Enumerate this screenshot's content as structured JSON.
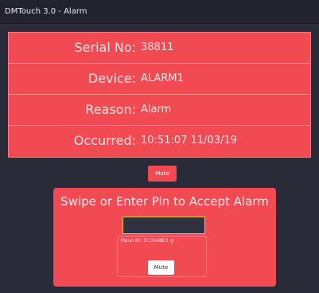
{
  "window": {
    "title": "DMTouch 3.0 - Alarm"
  },
  "alarm_info": [
    {
      "label": "Serial No:",
      "value": "38811"
    },
    {
      "label": "Device:",
      "value": "ALARM1"
    },
    {
      "label": "Reason:",
      "value": "Alarm"
    },
    {
      "label": "Occurred:",
      "value": "10:51:07 11/03/19"
    }
  ],
  "mute_top": {
    "label": "Mute"
  },
  "accept_panel": {
    "title": "Swipe or Enter Pin to Accept Alarm",
    "pin": {
      "value": ""
    },
    "panel_id": "Panel ID: BC3648D1 g",
    "mute_label": "Mute"
  },
  "colors": {
    "alarm_red": "#f24a52",
    "background": "#2a2b38",
    "titlebar": "#22232f",
    "pin_border": "#e3c25a"
  }
}
